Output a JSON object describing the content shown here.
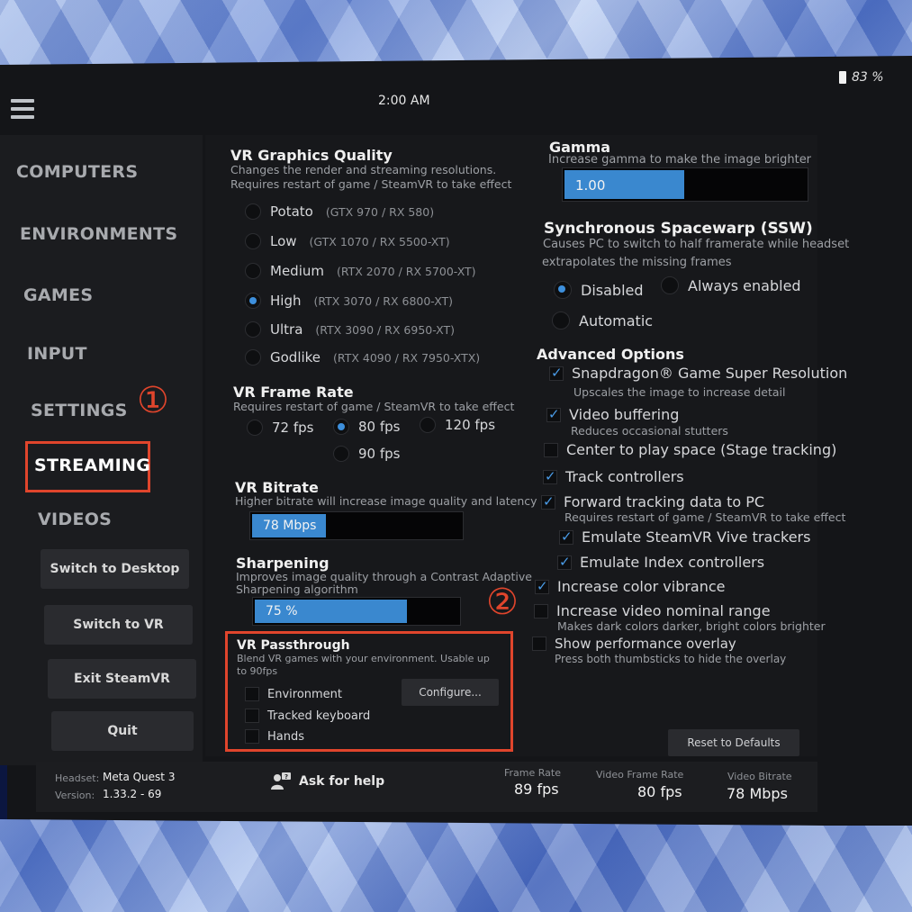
{
  "status": {
    "time": "2:00 AM",
    "battery": "83 %"
  },
  "nav": {
    "items": [
      {
        "label": "COMPUTERS"
      },
      {
        "label": "ENVIRONMENTS"
      },
      {
        "label": "GAMES"
      },
      {
        "label": "INPUT"
      },
      {
        "label": "SETTINGS"
      },
      {
        "label": "STREAMING"
      },
      {
        "label": "VIDEOS"
      }
    ],
    "buttons": {
      "switch_desktop": "Switch to Desktop",
      "switch_vr": "Switch to VR",
      "exit_steamvr": "Exit SteamVR",
      "quit": "Quit"
    }
  },
  "annotations": {
    "one": "①",
    "two": "②"
  },
  "graphics_quality": {
    "title": "VR Graphics Quality",
    "desc1": "Changes the render and streaming resolutions.",
    "desc2": "Requires restart of game / SteamVR to take effect",
    "options": [
      {
        "label": "Potato",
        "hint": "(GTX 970 / RX 580)",
        "selected": false
      },
      {
        "label": "Low",
        "hint": "(GTX 1070 / RX 5500-XT)",
        "selected": false
      },
      {
        "label": "Medium",
        "hint": "(RTX 2070 / RX 5700-XT)",
        "selected": false
      },
      {
        "label": "High",
        "hint": "(RTX 3070 / RX 6800-XT)",
        "selected": true
      },
      {
        "label": "Ultra",
        "hint": "(RTX 3090 / RX 6950-XT)",
        "selected": false
      },
      {
        "label": "Godlike",
        "hint": "(RTX 4090 / RX 7950-XTX)",
        "selected": false
      }
    ]
  },
  "frame_rate": {
    "title": "VR Frame Rate",
    "desc": "Requires restart of game / SteamVR to take effect",
    "options": [
      {
        "label": "72 fps",
        "selected": false
      },
      {
        "label": "80 fps",
        "selected": true
      },
      {
        "label": "120 fps",
        "selected": false
      },
      {
        "label": "90 fps",
        "selected": false
      }
    ]
  },
  "bitrate": {
    "title": "VR Bitrate",
    "desc": "Higher bitrate will increase image quality and latency",
    "value": "78 Mbps",
    "fill_fraction": 0.35
  },
  "sharpening": {
    "title": "Sharpening",
    "desc1": "Improves image quality through a Contrast Adaptive",
    "desc2": "Sharpening algorithm",
    "value": "75 %",
    "fill_fraction": 0.75
  },
  "passthrough": {
    "title": "VR Passthrough",
    "desc1": "Blend VR games with your environment. Usable up",
    "desc2": "to 90fps",
    "options": [
      {
        "label": "Environment",
        "checked": false
      },
      {
        "label": "Tracked keyboard",
        "checked": false
      },
      {
        "label": "Hands",
        "checked": false
      }
    ],
    "configure": "Configure..."
  },
  "gamma": {
    "title": "Gamma",
    "desc": "Increase gamma to make the image brighter",
    "value": "1.00",
    "fill_fraction": 0.5
  },
  "ssw": {
    "title": "Synchronous Spacewarp (SSW)",
    "desc1": "Causes PC to switch to half framerate while headset",
    "desc2": "extrapolates the missing frames",
    "options": [
      {
        "label": "Disabled",
        "selected": true
      },
      {
        "label": "Always enabled",
        "selected": false
      },
      {
        "label": "Automatic",
        "selected": false
      }
    ]
  },
  "advanced": {
    "title": "Advanced Options",
    "options": [
      {
        "label": "Snapdragon® Game Super Resolution",
        "sub": "Upscales the image to increase detail",
        "checked": true
      },
      {
        "label": "Video buffering",
        "sub": "Reduces occasional stutters",
        "checked": true
      },
      {
        "label": "Center to play space (Stage tracking)",
        "sub": "",
        "checked": false
      },
      {
        "label": "Track controllers",
        "sub": "",
        "checked": true
      },
      {
        "label": "Forward tracking data to PC",
        "sub": "Requires restart of game / SteamVR to take effect",
        "checked": true
      },
      {
        "label": "Emulate SteamVR Vive trackers",
        "sub": "",
        "checked": true
      },
      {
        "label": "Emulate Index controllers",
        "sub": "",
        "checked": true
      },
      {
        "label": "Increase color vibrance",
        "sub": "",
        "checked": true
      },
      {
        "label": "Increase video nominal range",
        "sub": "Makes dark colors darker, bright colors brighter",
        "checked": false
      },
      {
        "label": "Show performance overlay",
        "sub": "Press both thumbsticks to hide the overlay",
        "checked": false
      }
    ],
    "reset": "Reset to Defaults"
  },
  "footer": {
    "headset_label": "Headset:",
    "headset_value": "Meta Quest 3",
    "version_label": "Version:",
    "version_value": "1.33.2 - 69",
    "help": "Ask for help",
    "frame_rate_label": "Frame Rate",
    "frame_rate_value": "89 fps",
    "video_frame_rate_label": "Video Frame Rate",
    "video_frame_rate_value": "80 fps",
    "video_bitrate_label": "Video Bitrate",
    "video_bitrate_value": "78 Mbps"
  }
}
